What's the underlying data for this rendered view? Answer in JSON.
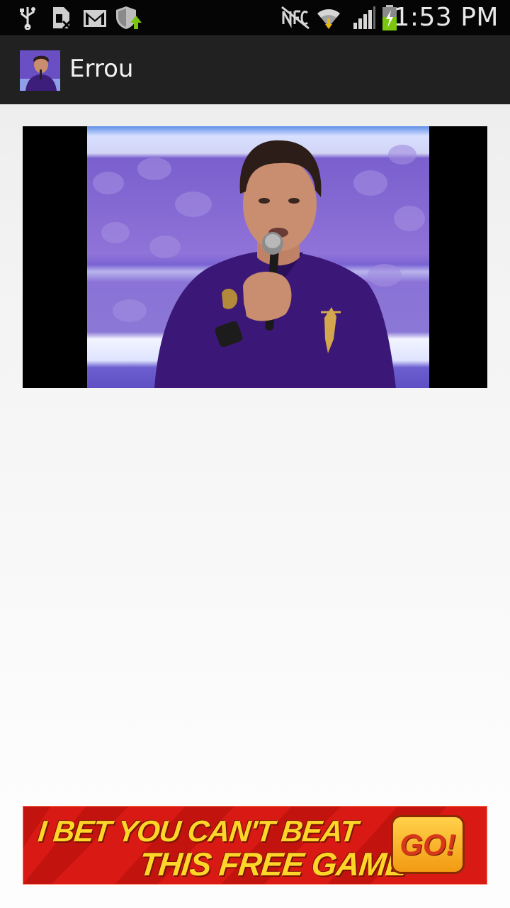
{
  "status_bar": {
    "time": "1:53 PM",
    "icons": [
      "usb-icon",
      "sim-card-missing-icon",
      "gmail-icon",
      "shield-update-icon",
      "nfc-off-icon",
      "wifi-icon",
      "signal-icon",
      "battery-charging-icon"
    ]
  },
  "action_bar": {
    "title": "Errou",
    "app_icon": "app-thumbnail-icon"
  },
  "ad": {
    "line1": "I BET YOU CAN'T BEAT",
    "line2": "THIS FREE GAME",
    "button": "GO!"
  },
  "colors": {
    "status_bar": "#050505",
    "action_bar": "#212121",
    "ad_background": "#d91a14",
    "ad_text": "#ffd52a"
  }
}
